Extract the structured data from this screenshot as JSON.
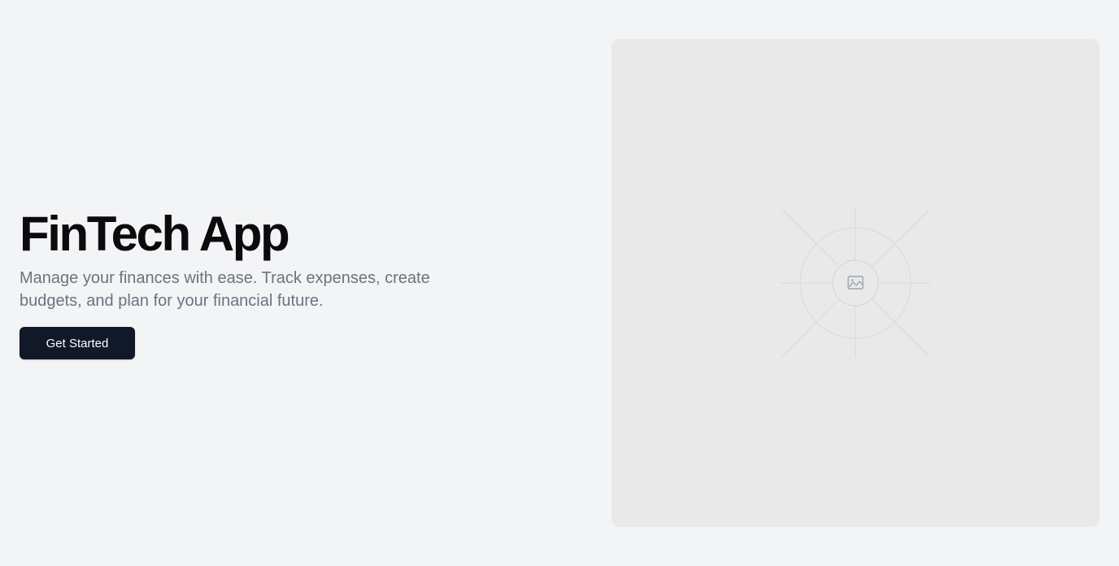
{
  "hero": {
    "title": "FinTech App",
    "subtitle": "Manage your finances with ease. Track expenses, create budgets, and plan for your financial future.",
    "cta_label": "Get Started"
  },
  "image_placeholder": {
    "icon": "image-icon"
  },
  "colors": {
    "page_background": "#f3f4f6",
    "placeholder_background": "#e9e9e9",
    "button_background": "#111827",
    "button_text": "#ffffff",
    "title_text": "#0b0b0d",
    "subtitle_text": "#6b7280"
  }
}
